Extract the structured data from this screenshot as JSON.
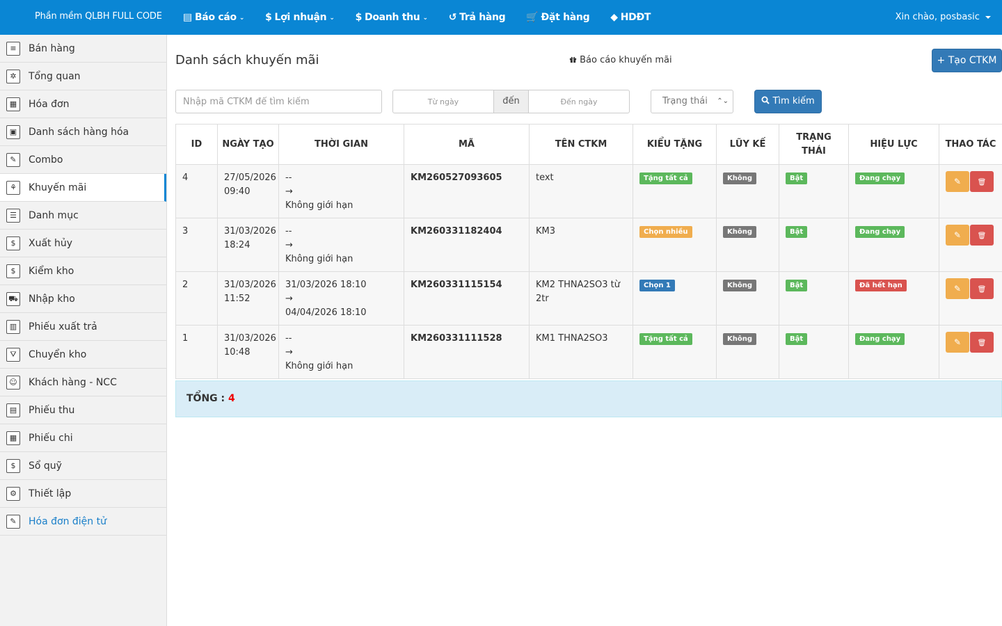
{
  "header": {
    "brand": "Phần mềm QLBH FULL CODE",
    "nav": [
      {
        "label": "Báo cáo",
        "icon": "file-icon",
        "glyph": "▤",
        "dropdown": true
      },
      {
        "label": "Lợi nhuận",
        "icon": "dollar-icon",
        "glyph": "$",
        "dropdown": true
      },
      {
        "label": "Doanh thu",
        "icon": "dollar-icon",
        "glyph": "$",
        "dropdown": true
      },
      {
        "label": "Trả hàng",
        "icon": "undo-icon",
        "glyph": "↺",
        "dropdown": false
      },
      {
        "label": "Đặt hàng",
        "icon": "cart-icon",
        "glyph": "🛒",
        "dropdown": false
      },
      {
        "label": "HDĐT",
        "icon": "tag-icon",
        "glyph": "◆",
        "dropdown": false
      }
    ],
    "user": "Xin chào, posbasic"
  },
  "sidebar": {
    "items": [
      {
        "label": "Bán hàng",
        "icon": "pos-icon",
        "glyph": "≡"
      },
      {
        "label": "Tổng quan",
        "icon": "dashboard-icon",
        "glyph": "✲"
      },
      {
        "label": "Hóa đơn",
        "icon": "invoice-icon",
        "glyph": "▦"
      },
      {
        "label": "Danh sách hàng hóa",
        "icon": "products-icon",
        "glyph": "▣"
      },
      {
        "label": "Combo",
        "icon": "combo-icon",
        "glyph": "✎"
      },
      {
        "label": "Khuyến mãi",
        "icon": "promotion-icon",
        "glyph": "⚘",
        "active": true
      },
      {
        "label": "Danh mục",
        "icon": "list-icon",
        "glyph": "☰"
      },
      {
        "label": "Xuất hủy",
        "icon": "export-cancel-icon",
        "glyph": "$"
      },
      {
        "label": "Kiểm kho",
        "icon": "stock-check-icon",
        "glyph": "$"
      },
      {
        "label": "Nhập kho",
        "icon": "cart-icon",
        "glyph": "⛟"
      },
      {
        "label": "Phiếu xuất trả",
        "icon": "return-slip-icon",
        "glyph": "▥"
      },
      {
        "label": "Chuyển kho",
        "icon": "funnel-icon",
        "glyph": "⛛"
      },
      {
        "label": "Khách hàng - NCC",
        "icon": "people-icon",
        "glyph": "☺"
      },
      {
        "label": "Phiếu thu",
        "icon": "receipt-icon",
        "glyph": "▤"
      },
      {
        "label": "Phiếu chi",
        "icon": "payment-icon",
        "glyph": "▦"
      },
      {
        "label": "Sổ quỹ",
        "icon": "cashbook-icon",
        "glyph": "$"
      },
      {
        "label": "Thiết lập",
        "icon": "gear-icon",
        "glyph": "⚙"
      },
      {
        "label": "Hóa đơn điện tử",
        "icon": "e-invoice-icon",
        "glyph": "✎",
        "link": true
      }
    ]
  },
  "page": {
    "title": "Danh sách khuyến mãi",
    "report_link": "Báo cáo khuyến mãi",
    "create_button": "+ Tạo CTKM"
  },
  "filters": {
    "search_placeholder": "Nhập mã CTKM để tìm kiếm",
    "from_placeholder": "Từ ngày",
    "separator": "đến",
    "to_placeholder": "Đến ngày",
    "status_selected": "Trạng thái",
    "search_button": "Tìm kiếm"
  },
  "table": {
    "headers": [
      "ID",
      "NGÀY TẠO",
      "THỜI GIAN",
      "MÃ",
      "TÊN CTKM",
      "KIỂU TẶNG",
      "LŨY KẾ",
      "TRẠNG THÁI",
      "HIỆU LỰC",
      "THAO TÁC"
    ],
    "rows": [
      {
        "id": "4",
        "created": [
          "27/05/2026",
          "09:40"
        ],
        "time": [
          "--",
          "→",
          "Không giới hạn"
        ],
        "code": "KM260527093605",
        "name": "text",
        "type": {
          "text": "Tặng tất cả",
          "color": "green"
        },
        "cumulative": "Không",
        "status": "Bật",
        "validity": {
          "text": "Đang chạy",
          "color": "green"
        }
      },
      {
        "id": "3",
        "created": [
          "31/03/2026",
          "18:24"
        ],
        "time": [
          "--",
          "→",
          "Không giới hạn"
        ],
        "code": "KM260331182404",
        "name": "KM3",
        "type": {
          "text": "Chọn nhiều",
          "color": "orange"
        },
        "cumulative": "Không",
        "status": "Bật",
        "validity": {
          "text": "Đang chạy",
          "color": "green"
        }
      },
      {
        "id": "2",
        "created": [
          "31/03/2026",
          "11:52"
        ],
        "time": [
          "31/03/2026 18:10",
          "→",
          "04/04/2026 18:10"
        ],
        "code": "KM260331115154",
        "name": "KM2 THNA2SO3 từ 2tr",
        "type": {
          "text": "Chọn 1",
          "color": "blue"
        },
        "cumulative": "Không",
        "status": "Bật",
        "validity": {
          "text": "Đã hết hạn",
          "color": "red"
        }
      },
      {
        "id": "1",
        "created": [
          "31/03/2026",
          "10:48"
        ],
        "time": [
          "--",
          "→",
          "Không giới hạn"
        ],
        "code": "KM260331111528",
        "name": "KM1 THNA2SO3",
        "type": {
          "text": "Tặng tất cả",
          "color": "green"
        },
        "cumulative": "Không",
        "status": "Bật",
        "validity": {
          "text": "Đang chạy",
          "color": "green"
        }
      }
    ]
  },
  "total": {
    "label": "TỔNG : ",
    "value": "4"
  },
  "colors": {
    "navbar": "#0a86d4",
    "primary": "#337ab7",
    "success": "#5cb85c",
    "warning": "#f0ad4e",
    "danger": "#d9534f"
  }
}
